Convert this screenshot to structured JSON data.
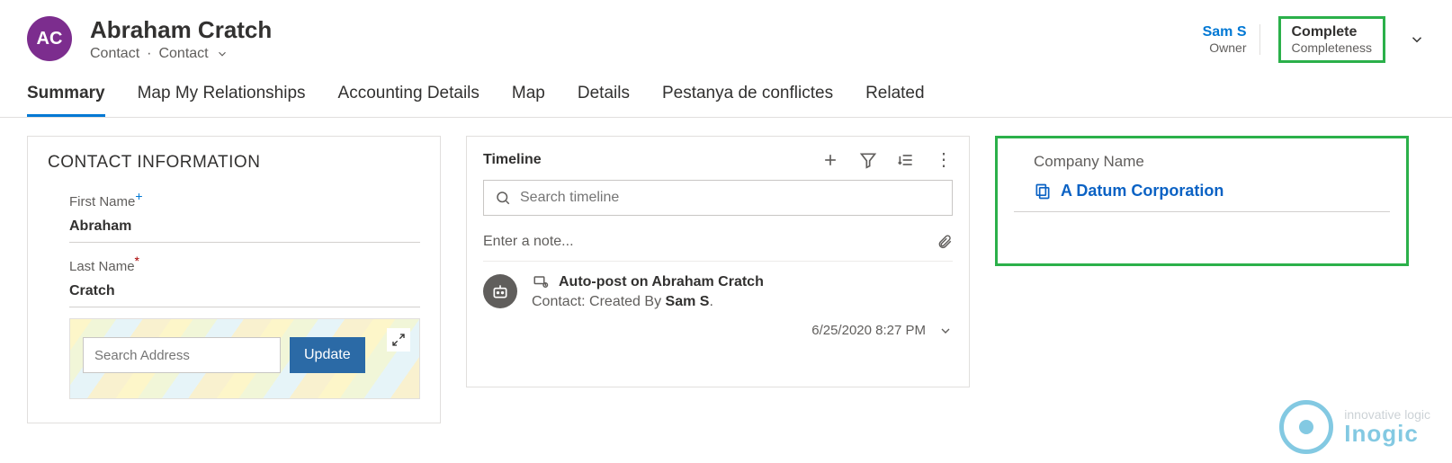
{
  "header": {
    "avatar_initials": "AC",
    "name": "Abraham Cratch",
    "entity_type": "Contact",
    "form_name": "Contact",
    "owner_value": "Sam S",
    "owner_label": "Owner",
    "completeness_value": "Complete",
    "completeness_label": "Completeness"
  },
  "tabs": [
    "Summary",
    "Map My Relationships",
    "Accounting Details",
    "Map",
    "Details",
    "Pestanya de conflictes",
    "Related"
  ],
  "contact_info": {
    "section_title": "CONTACT INFORMATION",
    "first_name_label": "First Name",
    "first_name_value": "Abraham",
    "last_name_label": "Last Name",
    "last_name_value": "Cratch",
    "search_placeholder": "Search Address",
    "update_label": "Update"
  },
  "timeline": {
    "title": "Timeline",
    "search_placeholder": "Search timeline",
    "note_placeholder": "Enter a note...",
    "post_title": "Auto-post on Abraham Cratch",
    "post_sub_prefix": "Contact: Created By ",
    "post_sub_author": "Sam S",
    "post_datetime": "6/25/2020 8:27 PM"
  },
  "right": {
    "label": "Company Name",
    "company_name": "A Datum Corporation"
  },
  "watermark": {
    "top": "innovative logic",
    "bottom": "Inogic"
  }
}
